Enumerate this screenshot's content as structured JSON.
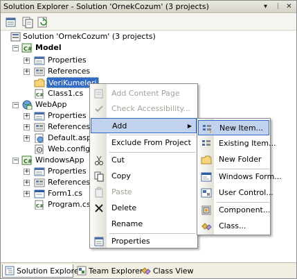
{
  "window": {
    "title": "Solution Explorer - Solution 'OrnekCozum' (3 projects)"
  },
  "title_buttons": {
    "dropdown": "▾",
    "pin": "ᛁ",
    "close": "✕"
  },
  "tree": {
    "solution": "Solution 'OrnekCozum' (3 projects)",
    "model": {
      "label": "Model",
      "properties": "Properties",
      "references": "References",
      "folder": "VeriKumeleri",
      "class1": "Class1.cs"
    },
    "webapp": {
      "label": "WebApp",
      "properties": "Properties",
      "references": "References",
      "default": "Default.aspx",
      "webconfig": "Web.config"
    },
    "windowsapp": {
      "label": "WindowsApp",
      "properties": "Properties",
      "references": "References",
      "form1": "Form1.cs",
      "program": "Program.cs"
    }
  },
  "context_menu": {
    "add_content_page": "Add Content Page",
    "check_accessibility": "Check Accessibility...",
    "add": "Add",
    "exclude": "Exclude From Project",
    "cut": "Cut",
    "copy": "Copy",
    "paste": "Paste",
    "delete": "Delete",
    "rename": "Rename",
    "properties": "Properties"
  },
  "submenu": {
    "new_item": "New Item...",
    "existing_item": "Existing Item...",
    "new_folder": "New Folder",
    "windows_form": "Windows Form...",
    "user_control": "User Control...",
    "component": "Component...",
    "class": "Class..."
  },
  "status_tabs": {
    "solution_explorer": "Solution Explorer",
    "team_explorer": "Team Explorer",
    "class_view": "Class View"
  },
  "colors": {
    "selection": "#316ac5",
    "highlight": "#c1d2ee",
    "toolbar_bg": "#f5f4ee"
  }
}
